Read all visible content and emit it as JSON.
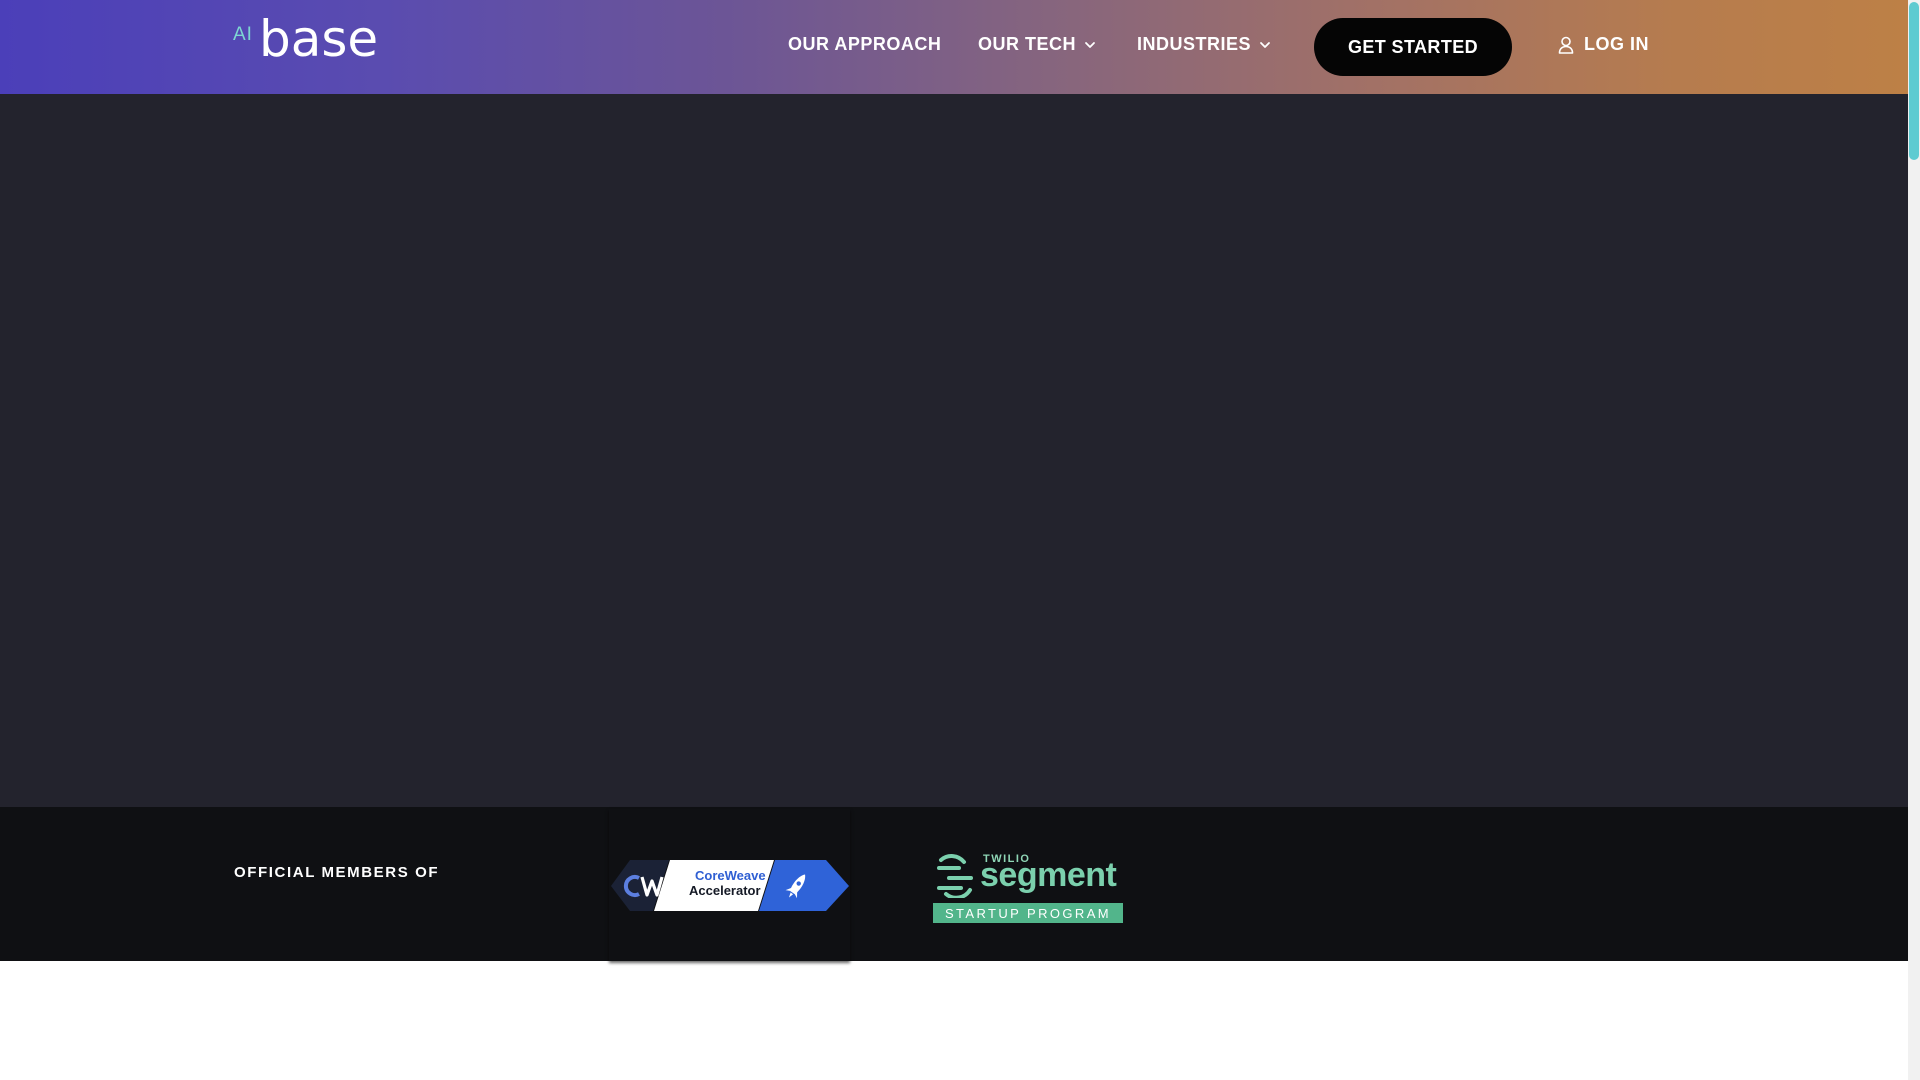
{
  "brand": {
    "logo_prefix": "AI",
    "logo_name": "base"
  },
  "nav": {
    "items": [
      {
        "label": "OUR APPROACH",
        "has_dropdown": false
      },
      {
        "label": "OUR TECH",
        "has_dropdown": true
      },
      {
        "label": "INDUSTRIES",
        "has_dropdown": true
      }
    ],
    "cta_label": "GET STARTED",
    "login_label": "LOG IN",
    "login_icon": "user-icon",
    "dropdown_icon": "chevron-down-icon"
  },
  "members": {
    "label": "OFFICIAL MEMBERS OF",
    "coreweave": {
      "line1": "CoreWeave",
      "line2": "Accelerator",
      "icon": "rocket-icon"
    },
    "segment": {
      "brand_small": "TWILIO",
      "brand_word": "segment",
      "program": "STARTUP PROGRAM"
    }
  },
  "colors": {
    "header_left": "#4b3fb9",
    "header_right": "#bd8046",
    "hero_bg": "#23232d",
    "members_bg": "#0f1013",
    "accent_teal": "#5ecbd1",
    "segment_green": "#52b58b",
    "coreweave_blue": "#2f5fd3"
  }
}
